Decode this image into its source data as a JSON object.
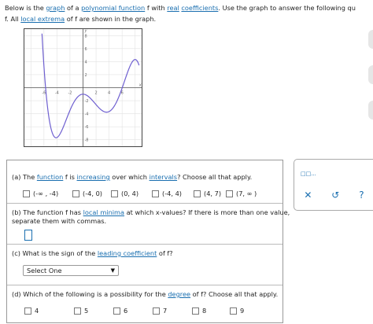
{
  "intro": {
    "line1_a": "Below is the ",
    "link_graph": "graph",
    "line1_b": " of a ",
    "link_polynomial": "polynomial function",
    "line1_c": " f with ",
    "link_real": "real",
    "line1_d": " ",
    "link_coefficients": "coefficients",
    "line1_e": ". Use the graph to answer the following qu",
    "line2_a": "f. All ",
    "link_local_extrema": "local extrema",
    "line2_b": " of f are shown in the graph."
  },
  "graph": {
    "x_label": "x",
    "y_label": "y",
    "x_tick_labels": [
      "-6",
      "-4",
      "-2",
      "2",
      "4",
      "6"
    ],
    "y_tick_labels": [
      "8",
      "6",
      "4",
      "2",
      "-2",
      "-4",
      "-6",
      "-8"
    ],
    "local_minima_x": [
      -4,
      4
    ],
    "local_maxima_x": [
      0,
      7
    ]
  },
  "q_a": {
    "text_a": "(a) The ",
    "link_function": "function",
    "text_b": " f is ",
    "link_increasing": "increasing",
    "text_c": " over which ",
    "link_intervals": "intervals",
    "text_d": "? Choose all that apply.",
    "options": [
      "(-∞ , -4)",
      "(-4, 0)",
      "(0, 4)",
      "(-4, 4)",
      "(4, 7)",
      "(7, ∞ )"
    ]
  },
  "q_b": {
    "text_a": "(b) The function f has ",
    "link_local_minima": "local minima",
    "text_b": " at which x-values? If there is more than one value,",
    "text_line2": "separate them with commas."
  },
  "q_c": {
    "text_a": "(c) What is the sign of the ",
    "link_leading": "leading coefficient",
    "text_b": " of f?",
    "select_value": "Select One"
  },
  "q_d": {
    "text_a": "(d) Which of the following is a possibility for the ",
    "link_degree": "degree",
    "text_b": " of f? Choose all that apply.",
    "options": [
      "4",
      "5",
      "6",
      "7",
      "8",
      "9"
    ]
  },
  "tools": {
    "top_icon": "□□...",
    "clear_icon": "✕",
    "undo_icon": "↺",
    "help_icon": "?"
  },
  "colors": {
    "link": "#1a6fb0",
    "curve": "#6e5fd0"
  }
}
